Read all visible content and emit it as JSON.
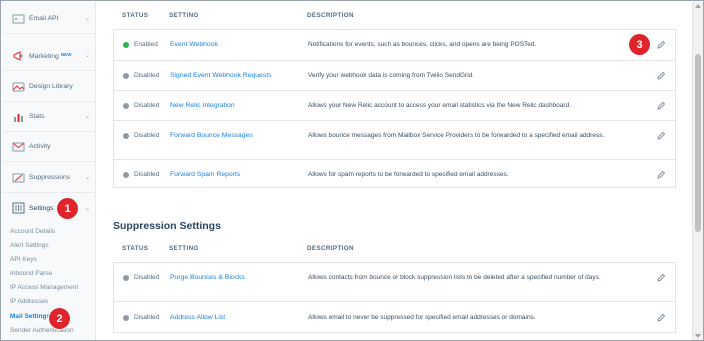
{
  "sidebar": {
    "items": [
      {
        "label": "Email API",
        "icon": "email-api-icon",
        "has_chevron": true
      },
      {
        "label": "Marketing",
        "badge": "NEW",
        "icon": "marketing-icon",
        "has_chevron": true
      },
      {
        "label": "Design Library",
        "icon": "design-library-icon",
        "has_chevron": false
      },
      {
        "label": "Stats",
        "icon": "stats-icon",
        "has_chevron": true
      },
      {
        "label": "Activity",
        "icon": "activity-icon",
        "has_chevron": false
      },
      {
        "label": "Suppressions",
        "icon": "suppressions-icon",
        "has_chevron": true
      },
      {
        "label": "Settings",
        "icon": "settings-icon",
        "has_chevron": true
      }
    ],
    "sub_items": [
      "Account Details",
      "Alert Settings",
      "API Keys",
      "Inbound Parse",
      "IP Access Management",
      "IP Addresses",
      "Mail Settings",
      "Sender Authentication"
    ],
    "active_sub_item": "Mail Settings"
  },
  "annotations": {
    "step1": "1",
    "step2": "2",
    "step3": "3",
    "color": "#e0242c"
  },
  "table_headers": {
    "status": "STATUS",
    "setting": "SETTING",
    "description": "DESCRIPTION"
  },
  "event_settings": [
    {
      "status": "Enabled",
      "enabled": true,
      "setting": "Event Webhook",
      "description": "Notifications for events, such as bounces, clicks, and opens are being POSTed."
    },
    {
      "status": "Disabled",
      "enabled": false,
      "setting": "Signed Event Webhook Requests",
      "description": "Verify your webhook data is coming from Twilio SendGrid."
    },
    {
      "status": "Disabled",
      "enabled": false,
      "setting": "New Relic Integration",
      "description": "Allows your New Relic account to access your email statistics via the New Relic dashboard."
    },
    {
      "status": "Disabled",
      "enabled": false,
      "setting": "Forward Bounce Messages",
      "description": "Allows bounce messages from Mailbox Service Providers to be forwarded to a specified email address."
    },
    {
      "status": "Disabled",
      "enabled": false,
      "setting": "Forward Spam Reports",
      "description": "Allows for spam reports to be forwarded to specified email addresses."
    }
  ],
  "suppression_section": {
    "title": "Suppression Settings",
    "rows": [
      {
        "status": "Disabled",
        "enabled": false,
        "setting": "Purge Bounces & Blocks",
        "description": "Allows contacts from bounce or block suppression lists to be deleted after a specified number of days."
      },
      {
        "status": "Disabled",
        "enabled": false,
        "setting": "Address Allow List",
        "description": "Allows email to never be suppressed for specified email addresses or domains."
      }
    ]
  },
  "colors": {
    "enabled": "#2fb34a",
    "disabled": "#8f98a3",
    "link": "#1a82e2"
  }
}
